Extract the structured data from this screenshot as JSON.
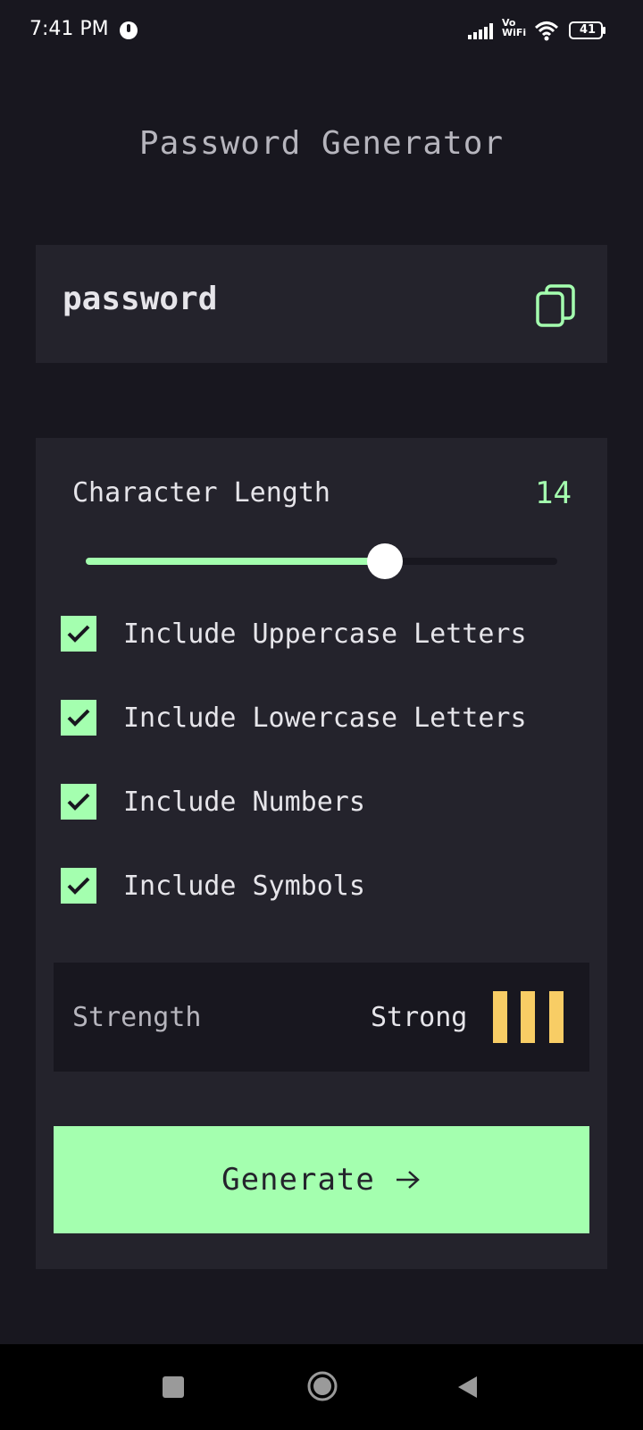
{
  "status_bar": {
    "time": "7:41 PM",
    "network_label_top": "Vo",
    "network_label_bottom": "WiFi",
    "battery": "41"
  },
  "app": {
    "title": "Password Generator"
  },
  "password": {
    "value": "password",
    "copy_icon": "copy-icon"
  },
  "options": {
    "length_label": "Character Length",
    "length_value": "14",
    "slider_fraction": 0.635,
    "checkboxes": [
      {
        "label": "Include Uppercase Letters",
        "checked": true
      },
      {
        "label": "Include Lowercase Letters",
        "checked": true
      },
      {
        "label": "Include Numbers",
        "checked": true
      },
      {
        "label": "Include Symbols",
        "checked": true
      }
    ],
    "strength": {
      "label": "Strength",
      "value": "Strong",
      "bars_filled": 3,
      "bar_color": "#f8cd65"
    },
    "generate_label": "Generate"
  },
  "colors": {
    "accent": "#a4ffaf",
    "background": "#18171f",
    "card": "#24232c",
    "warning": "#f8cd65"
  }
}
